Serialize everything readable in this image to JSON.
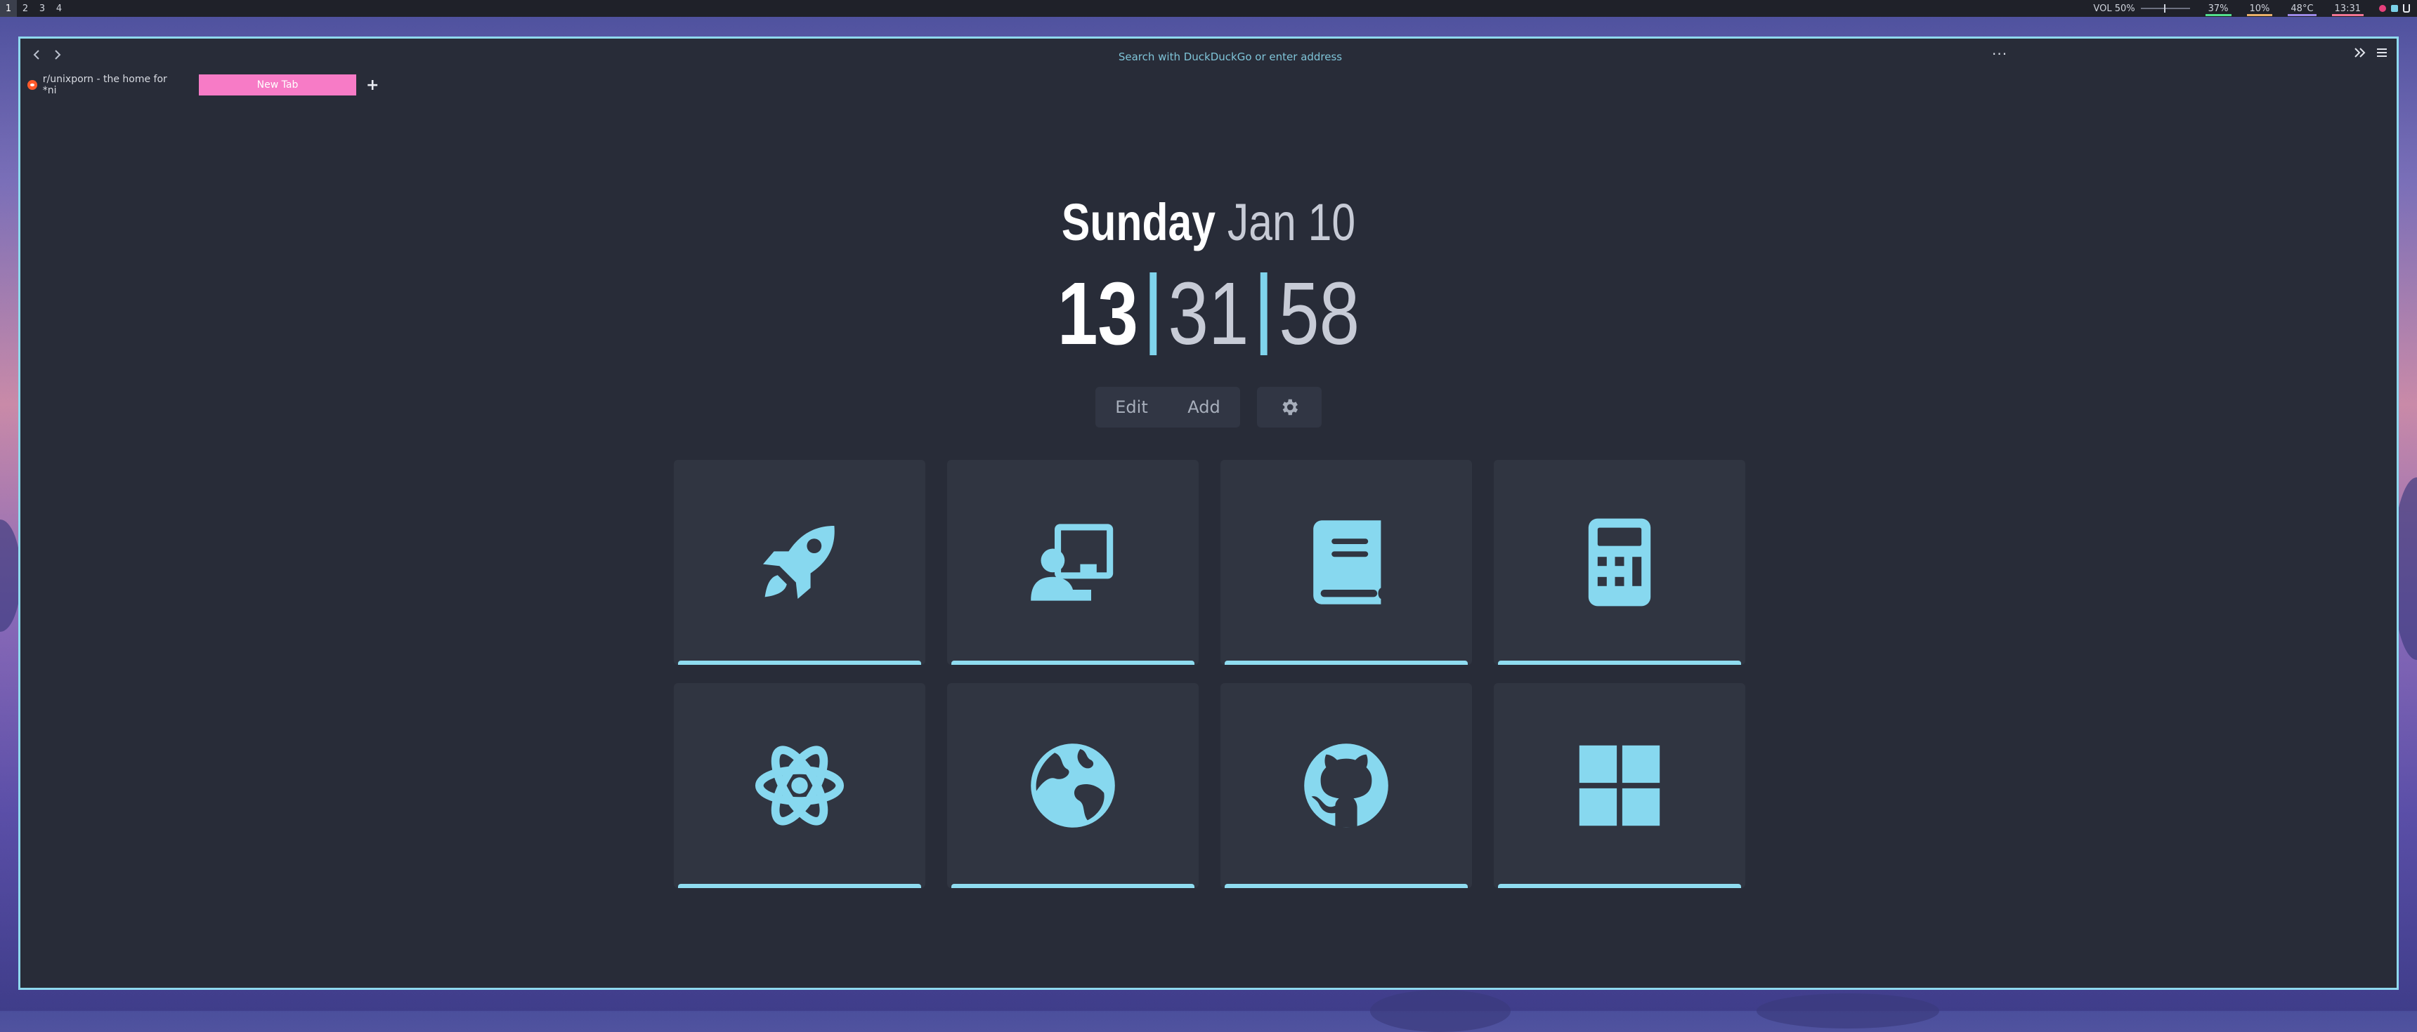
{
  "workspaces": [
    "1",
    "2",
    "3",
    "4"
  ],
  "active_workspace": "1",
  "status_bar": {
    "volume": "VOL 50%",
    "volume_level_percent": 50,
    "modules": [
      {
        "label": "37%",
        "underline": "#52e08d"
      },
      {
        "label": "10%",
        "underline": "#e9b06a"
      },
      {
        "label": "48°C",
        "underline": "#9c89e8"
      },
      {
        "label": "13:31",
        "underline": "#f07593"
      }
    ]
  },
  "browser": {
    "url_placeholder": "Search with DuckDuckGo or enter address",
    "tabs": [
      {
        "title": "r/unixporn - the home for *ni",
        "active": false
      },
      {
        "title": "New Tab",
        "active": true
      }
    ],
    "new_tab_symbol": "+",
    "menu_dots": "···"
  },
  "newtab": {
    "day": "Sunday",
    "date": "Jan 10",
    "hour": "13",
    "minute": "31",
    "second": "58",
    "edit_label": "Edit",
    "add_label": "Add",
    "tiles": [
      {
        "icon": "rocket-icon"
      },
      {
        "icon": "presentation-icon"
      },
      {
        "icon": "book-icon"
      },
      {
        "icon": "calculator-icon"
      },
      {
        "icon": "atom-icon"
      },
      {
        "icon": "globe-icon"
      },
      {
        "icon": "github-icon"
      },
      {
        "icon": "windows-icon"
      }
    ]
  },
  "colors": {
    "accent": "#87d8ef",
    "tab_active": "#f77bc6",
    "background": "#282c38",
    "tile": "#303541"
  }
}
